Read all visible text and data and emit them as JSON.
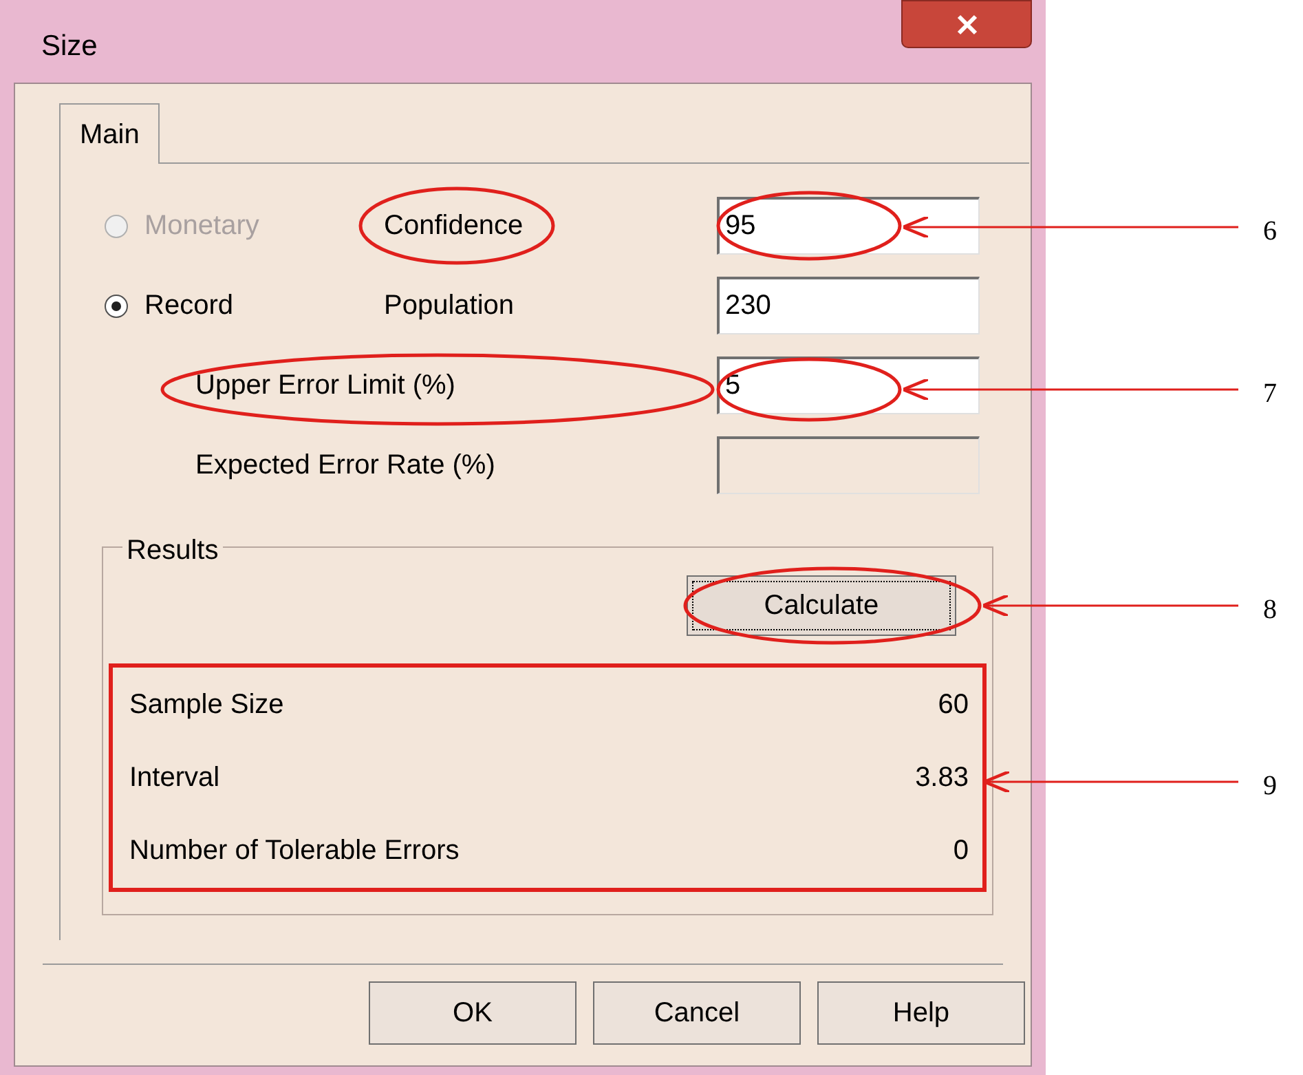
{
  "window": {
    "title": "Size"
  },
  "tabs": [
    {
      "label": "Main",
      "selected": true
    }
  ],
  "basis_options": [
    {
      "label": "Monetary",
      "selected": false,
      "disabled": true
    },
    {
      "label": "Record",
      "selected": true,
      "disabled": false
    }
  ],
  "fields": [
    {
      "label": "Confidence",
      "value": "95",
      "disabled": false
    },
    {
      "label": "Population",
      "value": "230",
      "disabled": false
    },
    {
      "label": "Upper Error Limit (%)",
      "value": "5",
      "disabled": false
    },
    {
      "label": "Expected Error Rate (%)",
      "disabled": true
    }
  ],
  "results": {
    "title": "Results",
    "calculate_button": "Calculate",
    "rows": [
      {
        "label": "Sample Size",
        "value": "60"
      },
      {
        "label": "Interval",
        "value": "3.83"
      },
      {
        "label": "Number of Tolerable Errors",
        "value": "0"
      }
    ]
  },
  "buttons": [
    "OK",
    "Cancel",
    "Help"
  ],
  "annotations": [
    {
      "number": "6"
    },
    {
      "number": "7"
    },
    {
      "number": "8"
    },
    {
      "number": "9"
    }
  ]
}
